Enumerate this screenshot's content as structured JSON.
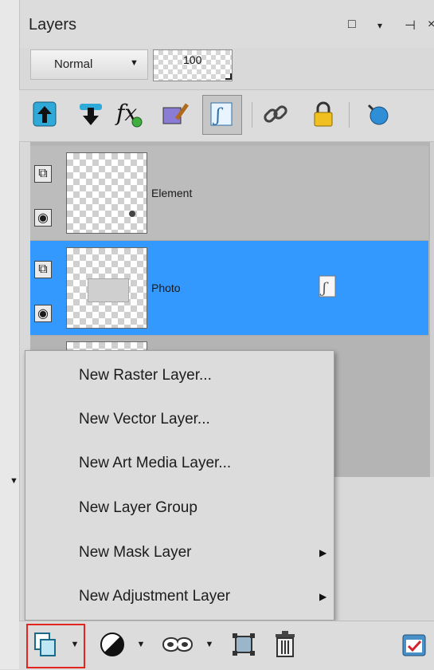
{
  "panel": {
    "title": "Layers"
  },
  "window_buttons": {
    "restore": "□",
    "menu": "▾",
    "pin": "⊣",
    "close": "×"
  },
  "blend": {
    "mode": "Normal",
    "opacity": "100"
  },
  "toolbar": {
    "icons": [
      "move-up-icon",
      "move-down-icon",
      "layer-properties-icon",
      "edit-layer-icon",
      "adjustment-icon",
      "link-icon",
      "lock-icon",
      "mask-icon"
    ]
  },
  "layers": [
    {
      "name": "Element",
      "selected": false
    },
    {
      "name": "Photo",
      "selected": true
    }
  ],
  "menu": {
    "items": [
      {
        "label": "New Raster Layer...",
        "submenu": false
      },
      {
        "label": "New Vector Layer...",
        "submenu": false
      },
      {
        "label": "New Art Media Layer...",
        "submenu": false
      },
      {
        "label": "New Layer Group",
        "submenu": false
      },
      {
        "label": "New Mask Layer",
        "submenu": true
      },
      {
        "label": "New Adjustment Layer",
        "submenu": true
      }
    ]
  },
  "colors": {
    "selection": "#3399ff",
    "highlight_border": "#e3251f"
  }
}
